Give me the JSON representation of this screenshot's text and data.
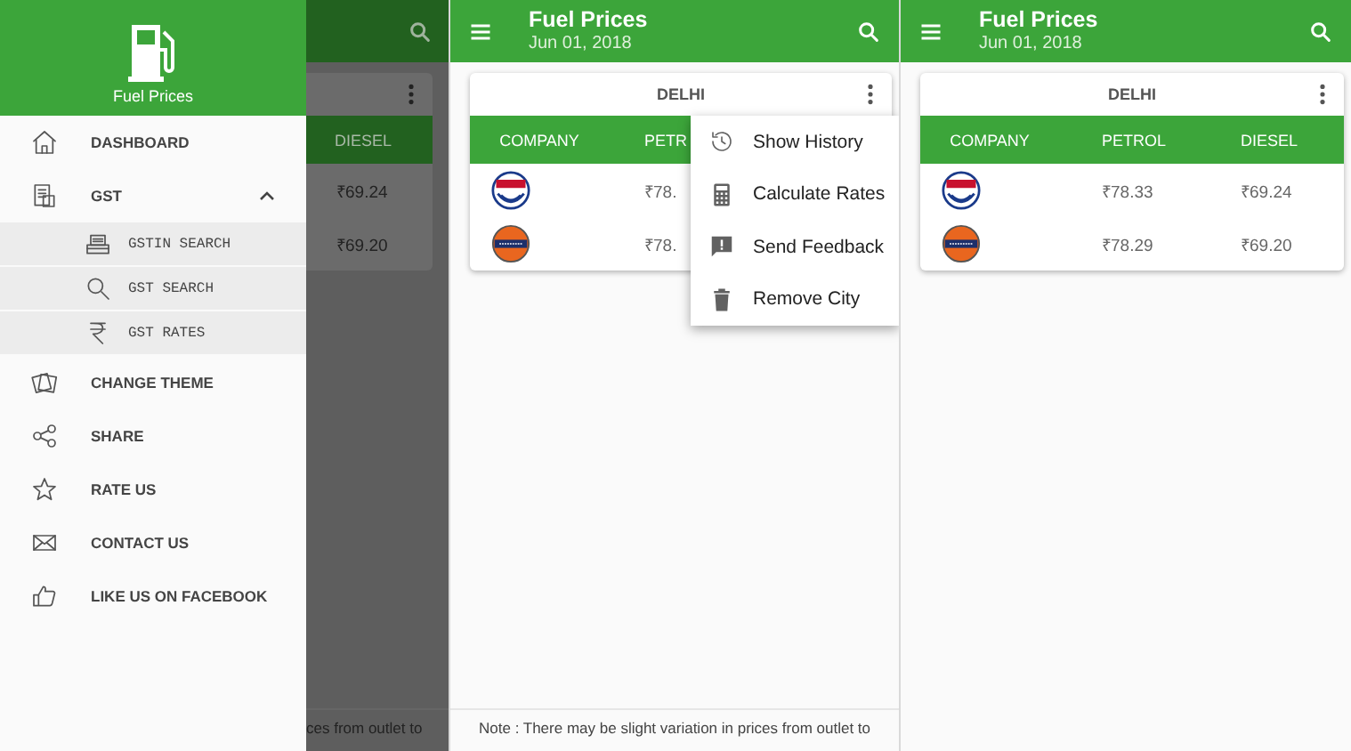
{
  "drawer_screen": {
    "drawer": {
      "title": "Fuel Prices",
      "items": [
        {
          "label": "DASHBOARD"
        },
        {
          "label": "GST",
          "expanded": true,
          "children": [
            {
              "label": "GSTIN SEARCH"
            },
            {
              "label": "GST SEARCH"
            },
            {
              "label": "GST RATES"
            }
          ]
        },
        {
          "label": "CHANGE THEME"
        },
        {
          "label": "SHARE"
        },
        {
          "label": "RATE US"
        },
        {
          "label": "CONTACT US"
        },
        {
          "label": "LIKE US ON FACEBOOK"
        }
      ]
    },
    "background": {
      "column_header": "DIESEL",
      "cells": [
        "₹69.24",
        "₹69.20"
      ],
      "note": "ces from outlet to"
    }
  },
  "menu_screen": {
    "app_bar": {
      "title": "Fuel Prices",
      "date": "Jun 01, 2018"
    },
    "card": {
      "city": "DELHI",
      "columns": [
        "COMPANY",
        "PETR"
      ],
      "rows": [
        {
          "cells": [
            "",
            "₹78."
          ]
        },
        {
          "cells": [
            "",
            "₹78."
          ]
        }
      ]
    },
    "menu": [
      {
        "label": "Show History"
      },
      {
        "label": "Calculate Rates"
      },
      {
        "label": "Send Feedback"
      },
      {
        "label": "Remove City"
      }
    ],
    "note": "Note : There may be slight variation in prices from outlet to"
  },
  "table_screen": {
    "app_bar": {
      "title": "Fuel Prices",
      "date": "Jun 01, 2018"
    },
    "card": {
      "city": "DELHI",
      "columns": [
        "COMPANY",
        "PETROL",
        "DIESEL"
      ],
      "rows": [
        {
          "cells": [
            "",
            "₹78.33",
            "₹69.24"
          ]
        },
        {
          "cells": [
            "",
            "₹78.29",
            "₹69.20"
          ]
        }
      ]
    }
  }
}
